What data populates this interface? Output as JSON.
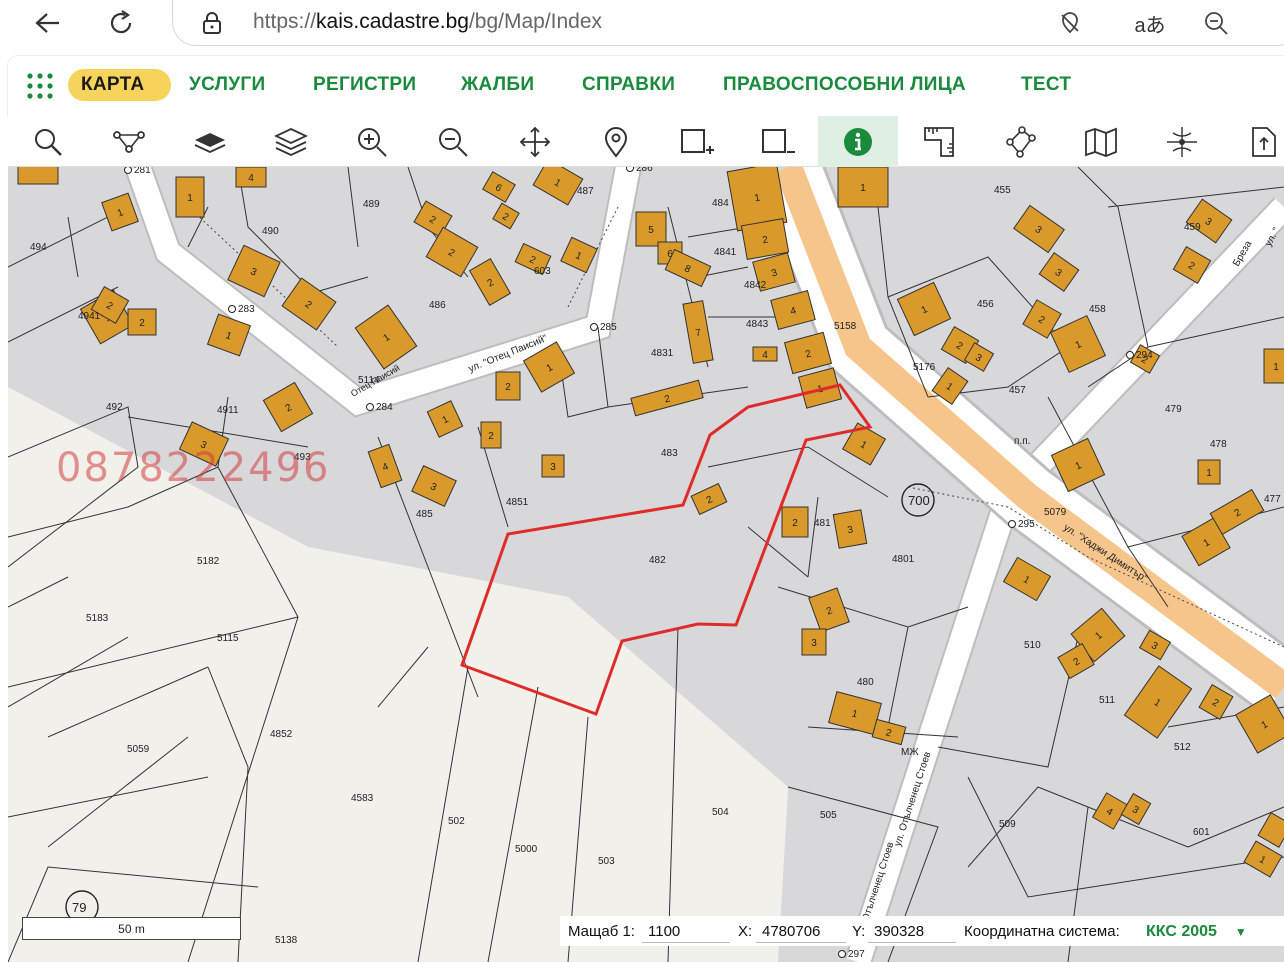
{
  "browser": {
    "url_prefix": "https://",
    "url_domain": "kais.cadastre.bg",
    "url_path": "/bg/Map/Index",
    "icons": [
      "back-icon",
      "reload-icon",
      "lock-icon",
      "tracking-prevention-icon",
      "translate-icon",
      "zoom-out-icon"
    ]
  },
  "nav": {
    "items": [
      {
        "label": "КАРТА",
        "active": true
      },
      {
        "label": "УСЛУГИ"
      },
      {
        "label": "РЕГИСТРИ"
      },
      {
        "label": "ЖАЛБИ"
      },
      {
        "label": "СПРАВКИ"
      },
      {
        "label": "ПРАВОСПОСОБНИ ЛИЦА"
      },
      {
        "label": "ТЕСТ"
      }
    ]
  },
  "toolbar": {
    "tools": [
      "search-icon",
      "route-icon",
      "layer-icon",
      "layers-stack-icon",
      "zoom-in-icon",
      "zoom-out-icon",
      "pan-icon",
      "location-pin-icon",
      "add-area-icon",
      "remove-area-icon",
      "info-icon",
      "measure-icon",
      "polygon-icon",
      "map-book-icon",
      "coordinates-icon",
      "export-icon"
    ],
    "active_tool": "info-icon"
  },
  "map": {
    "watermark": "0878222496",
    "street_labels": [
      "ул. \"Отец Паисий\"",
      "Отец Паисий",
      "ул. \"Хаджи Димитър\"",
      "ул. Отълченец Стоев",
      "Отълченец Стоев",
      "Бреза",
      "ул. \""
    ],
    "parcel_numbers": [
      "494",
      "489",
      "490",
      "487",
      "484",
      "455",
      "459",
      "486",
      "603",
      "4841",
      "4842",
      "4843",
      "5158",
      "456",
      "458",
      "4941",
      "492",
      "4911",
      "485",
      "4851",
      "483",
      "482",
      "481",
      "4801",
      "5176",
      "457",
      "479",
      "478",
      "477",
      "5079",
      "5182",
      "5183",
      "5115",
      "510",
      "511",
      "512",
      "480",
      "5059",
      "4852",
      "4583",
      "502",
      "5000",
      "503",
      "504",
      "505",
      "509",
      "601",
      "5138",
      "5114",
      "4831",
      "493"
    ],
    "point_labels": [
      "281",
      "286",
      "283",
      "285",
      "284",
      "294",
      "295",
      "297",
      "700",
      "79",
      "МЖ",
      "п.п."
    ],
    "colors": {
      "building": "#d99a2b",
      "outline": "#e02b2b",
      "road_orange": "#f6c58c",
      "gray_area": "#d7d7da",
      "paper": "#f2f0ea"
    }
  },
  "scale": {
    "label": "50 m"
  },
  "status": {
    "scale_label": "Мащаб 1:",
    "scale_value": "1100",
    "x_label": "X:",
    "x_value": "4780706",
    "y_label": "Y:",
    "y_value": "390328",
    "crs_label": "Координатна система:",
    "crs_value": "ККС 2005"
  }
}
